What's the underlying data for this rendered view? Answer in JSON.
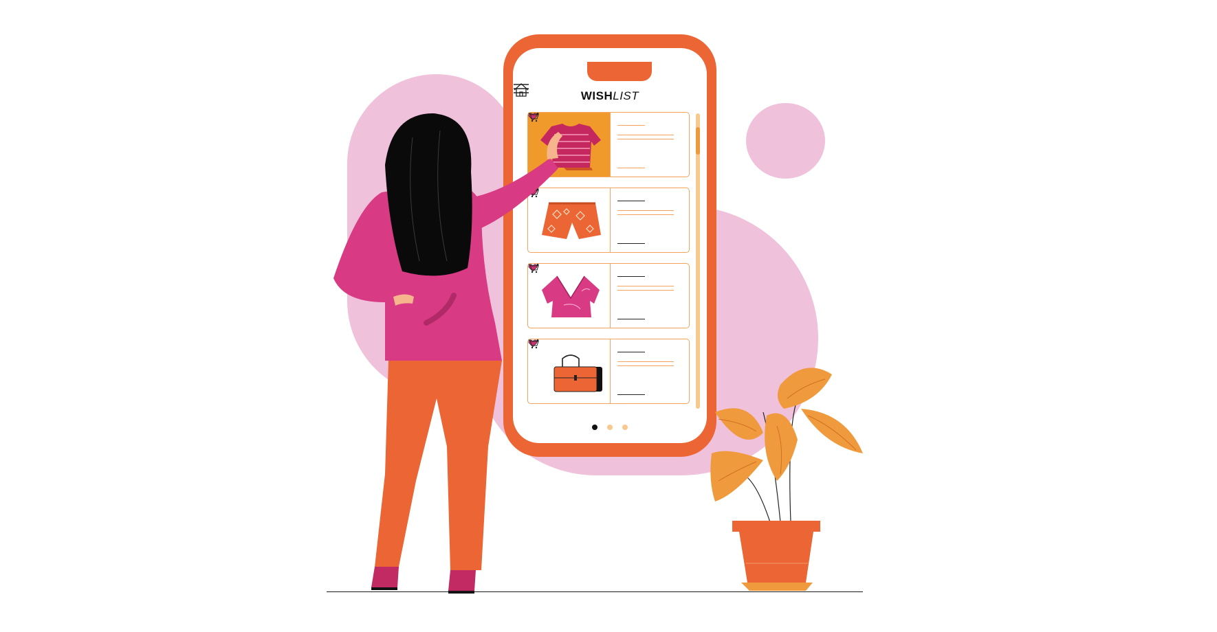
{
  "app": {
    "title_bold": "WISH",
    "title_italic": "LIST"
  },
  "header": {
    "home_icon": "home-icon",
    "menu_icon": "hamburger-menu-icon"
  },
  "wishlist": {
    "items": [
      {
        "product": "striped-tshirt-icon",
        "favorite": true,
        "cart_icon": "cart-icon",
        "selected": true
      },
      {
        "product": "patterned-shorts-icon",
        "favorite": true,
        "cart_icon": "cart-icon",
        "selected": false
      },
      {
        "product": "wrap-top-icon",
        "favorite": true,
        "cart_icon": "cart-icon",
        "selected": false
      },
      {
        "product": "handbag-icon",
        "favorite": true,
        "cart_icon": "cart-icon",
        "selected": false
      }
    ]
  },
  "pagination": {
    "pages": 3,
    "current": 1
  },
  "colors": {
    "phone": "#ec6534",
    "accent_orange": "#ef9a2b",
    "pink": "#d73c80",
    "blob": "#f0c1db",
    "heart": "#c8326e"
  }
}
